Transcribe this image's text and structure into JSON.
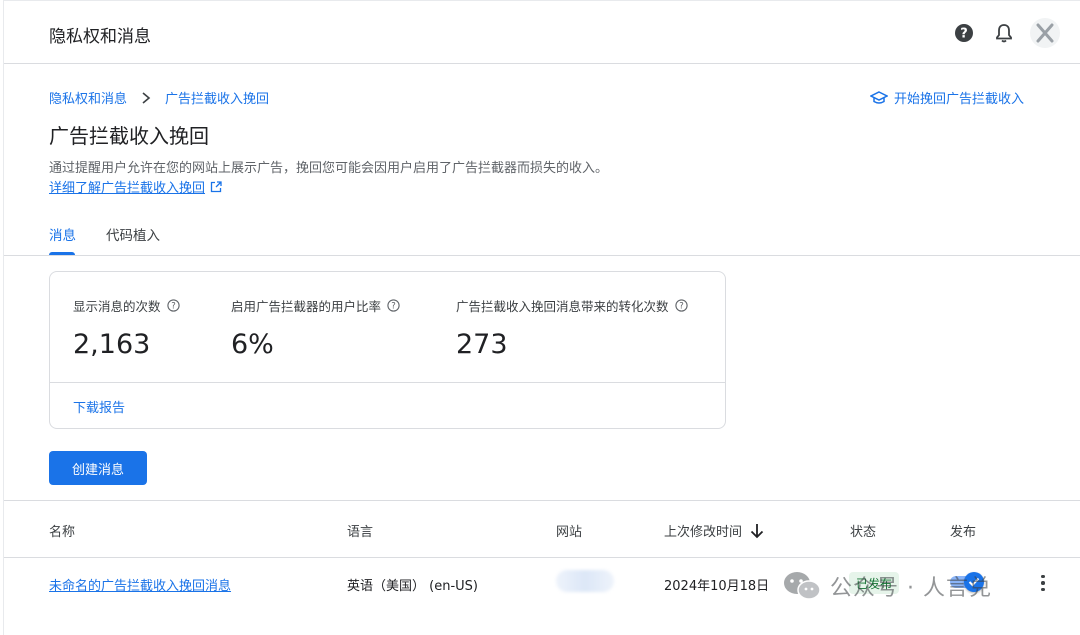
{
  "header": {
    "title": "隐私权和消息",
    "icons": [
      "help-icon",
      "bell-icon",
      "avatar"
    ]
  },
  "breadcrumb": {
    "items": [
      "隐私权和消息",
      "广告拦截收入挽回"
    ]
  },
  "start_link": "开始挽回广告拦截收入",
  "page": {
    "title": "广告拦截收入挽回",
    "description": "通过提醒用户允许在您的网站上展示广告，挽回您可能会因用户启用了广告拦截器而损失的收入。",
    "learn_more": "详细了解广告拦截收入挽回"
  },
  "tabs": [
    {
      "label": "消息",
      "active": true
    },
    {
      "label": "代码植入",
      "active": false
    }
  ],
  "stats": [
    {
      "label": "显示消息的次数",
      "value": "2,163"
    },
    {
      "label": "启用广告拦截器的用户比率",
      "value": "6%"
    },
    {
      "label": "广告拦截收入挽回消息带来的转化次数",
      "value": "273"
    }
  ],
  "download_report": "下载报告",
  "create_button": "创建消息",
  "table": {
    "columns": [
      "名称",
      "语言",
      "网站",
      "上次修改时间",
      "状态",
      "发布"
    ],
    "sort_column": "上次修改时间",
    "sort_direction": "descending",
    "rows": [
      {
        "name": "未命名的广告拦截收入挽回消息",
        "language": "英语（美国） (en-US)",
        "modified": "2024年10月18日",
        "status": "已发布",
        "published": true
      }
    ]
  },
  "watermark": "公众号 · 人言兑",
  "colors": {
    "accent": "#1a73e8",
    "status_bg": "#e6f4ea",
    "status_fg": "#137333",
    "divider": "#dadce0"
  }
}
